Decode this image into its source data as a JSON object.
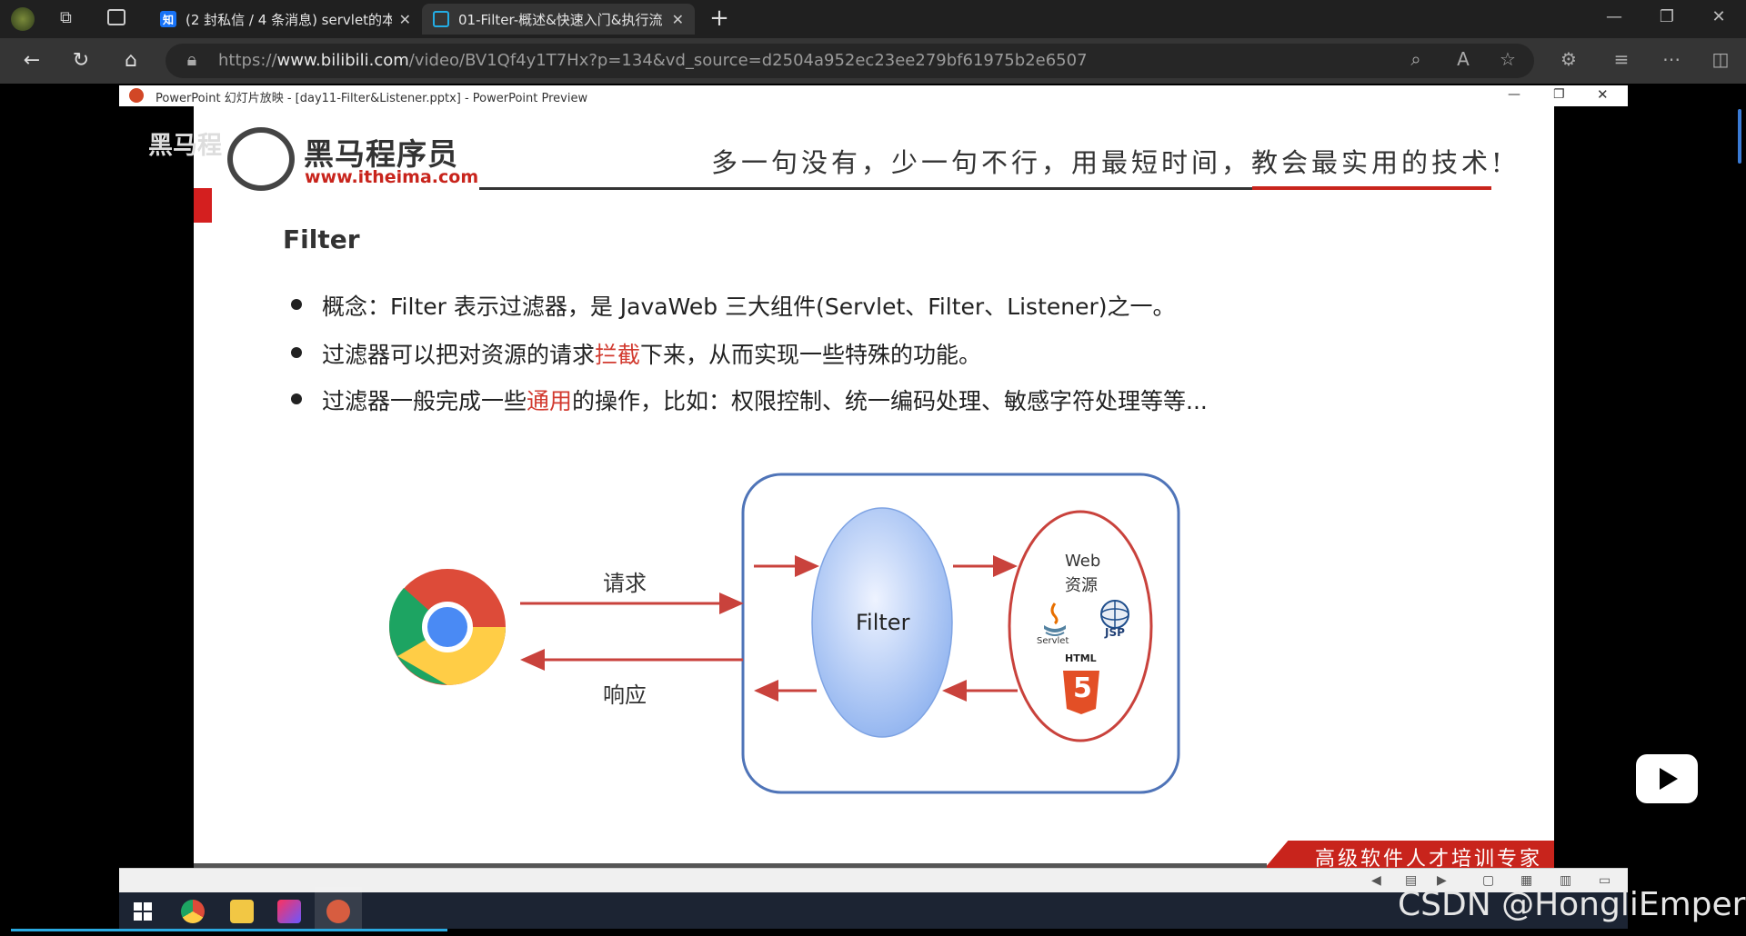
{
  "browser": {
    "tabs": [
      {
        "label": "(2 封私信 / 4 条消息) servlet的本"
      },
      {
        "label": "01-Filter-概述&快速入门&执行流"
      }
    ],
    "url_prefix": "https://",
    "url_host": "www.bilibili.com",
    "url_path": "/video/BV1Qf4y1T7Hx?p=134&vd_source=d2504a952ec23ee279bf61975b2e6507"
  },
  "ppt": {
    "window_title": "PowerPoint 幻灯片放映 - [day11-Filter&Listener.pptx] - PowerPoint Preview",
    "logo_name": "黑马程序员",
    "logo_url": "www.itheima.com",
    "watermark_left": "黑马程",
    "slogan": "多一句没有，少一句不行，用最短时间，教会最实用的技术!",
    "slide_title": "Filter",
    "bullet1": "概念：Filter 表示过滤器，是 JavaWeb 三大组件(Servlet、Filter、Listener)之一。",
    "bullet2_a": "过滤器可以把对资源的请求",
    "bullet2_red": "拦截",
    "bullet2_b": "下来，从而实现一些特殊的功能。",
    "bullet3_a": "过滤器一般完成一些",
    "bullet3_red": "通用",
    "bullet3_b": "的操作，比如：权限控制、统一编码处理、敏感字符处理等等...",
    "diagram": {
      "request_label": "请求",
      "response_label": "响应",
      "filter_label": "Filter",
      "web_label_1": "Web",
      "web_label_2": "资源",
      "servlet_label": "Servlet",
      "jsp_label": "JSP",
      "html_label": "HTML",
      "html_digit": "5"
    },
    "footer_banner": "高级软件人才培训专家"
  },
  "watermark": "CSDN @HongliEmperor",
  "colors": {
    "accent_red": "#d23a2f",
    "diagram_blue": "#4f74b8",
    "arrow_red": "#c9423c"
  }
}
